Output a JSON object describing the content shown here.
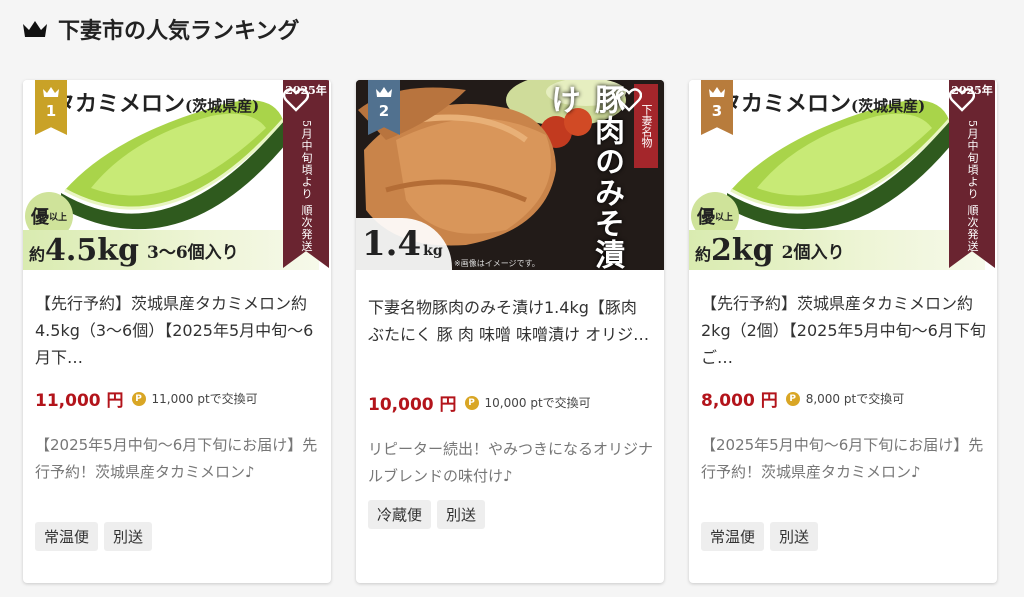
{
  "section": {
    "title": "下妻市の人気ランキング",
    "icon": "crown-icon"
  },
  "products": [
    {
      "rank": "1",
      "title": "【先行予約】茨城県産タカミメロン約4.5kg（3～6個）【2025年5月中旬～6月下…",
      "price": "11,000 円",
      "points": "11,000 ptで交換可",
      "description": "【2025年5月中旬～6月下旬にお届け】先行予約！茨城県産タカミメロン♪",
      "tags": [
        "常温便",
        "別送"
      ],
      "image": {
        "headline": "タカミメロン",
        "headline_sub": "(茨城県産)",
        "grade": "優",
        "grade_sub": "以上",
        "weight_label": "約",
        "weight": "4.5kg",
        "count": "3～6個入り",
        "ribbon_year": "2025年",
        "ribbon_text": "5月中旬頃より 順次発送"
      }
    },
    {
      "rank": "2",
      "title": "下妻名物豚肉のみそ漬け1.4kg【豚肉 ぶたにく 豚 肉 味噌 味噌漬け オリジ…",
      "price": "10,000 円",
      "points": "10,000 ptで交換可",
      "description": "リピーター続出！やみつきになるオリジナルブレンドの味付け♪",
      "tags": [
        "冷蔵便",
        "別送"
      ],
      "image": {
        "headline": "豚肉のみそ漬け",
        "tag": "下妻名物",
        "weight": "1.4",
        "weight_unit": "kg",
        "note": "※画像はイメージです。"
      }
    },
    {
      "rank": "3",
      "title": "【先行予約】茨城県産タカミメロン約2kg（2個）【2025年5月中旬～6月下旬ご…",
      "price": "8,000 円",
      "points": "8,000 ptで交換可",
      "description": "【2025年5月中旬～6月下旬にお届け】先行予約！茨城県産タカミメロン♪",
      "tags": [
        "常温便",
        "別送"
      ],
      "image": {
        "headline": "タカミメロン",
        "headline_sub": "(茨城県産)",
        "grade": "優",
        "grade_sub": "以上",
        "weight_label": "約",
        "weight": "2kg",
        "count": "2個入り",
        "ribbon_year": "2025年",
        "ribbon_text": "5月中旬頃より 順次発送"
      }
    }
  ],
  "colors": {
    "price": "#b3141b",
    "rank1": "#c9a227",
    "rank2": "#51718f",
    "rank3": "#b87c3c",
    "ribbon": "#6a2430",
    "points_icon": "#d9a625"
  }
}
